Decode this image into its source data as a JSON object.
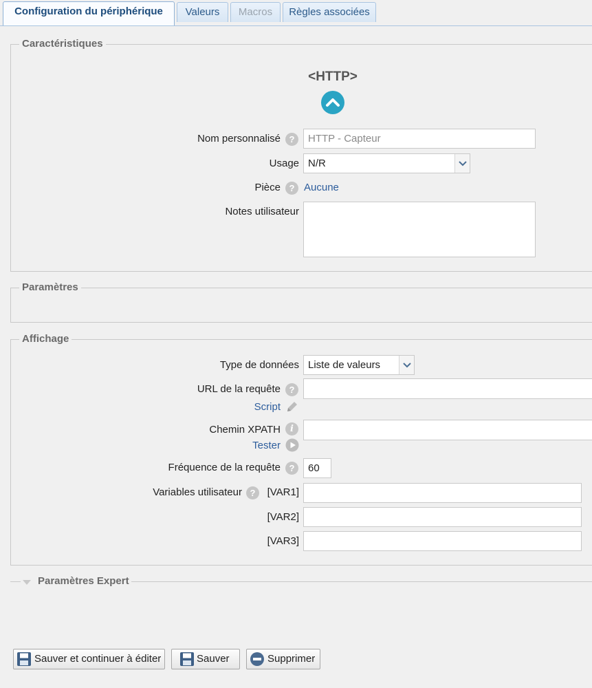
{
  "tabs": [
    {
      "label": "Configuration du périphérique"
    },
    {
      "label": "Valeurs"
    },
    {
      "label": "Macros"
    },
    {
      "label": "Règles associées"
    }
  ],
  "characteristics": {
    "legend": "Caractéristiques",
    "device_title": "<HTTP>",
    "custom_name_label": "Nom personnalisé",
    "custom_name_placeholder": "HTTP - Capteur",
    "usage_label": "Usage",
    "usage_value": "N/R",
    "room_label": "Pièce",
    "room_value": "Aucune",
    "notes_label": "Notes utilisateur"
  },
  "parameters": {
    "legend": "Paramètres"
  },
  "display": {
    "legend": "Affichage",
    "data_type_label": "Type de données",
    "data_type_value": "Liste de valeurs",
    "url_label": "URL de la requête",
    "script_link": "Script",
    "xpath_label": "Chemin XPATH",
    "test_link": "Tester",
    "frequency_label": "Fréquence de la requête",
    "frequency_value": "60",
    "user_vars_label": "Variables utilisateur",
    "var1_label": "[VAR1]",
    "var2_label": "[VAR2]",
    "var3_label": "[VAR3]"
  },
  "expert": {
    "label": "Paramètres Expert"
  },
  "buttons": {
    "save_continue": "Sauver et continuer à éditer",
    "save": "Sauver",
    "delete": "Supprimer"
  },
  "colors": {
    "accent": "#2aa4c4",
    "link": "#2d5d9c",
    "tab_border": "#a9c4e0"
  }
}
